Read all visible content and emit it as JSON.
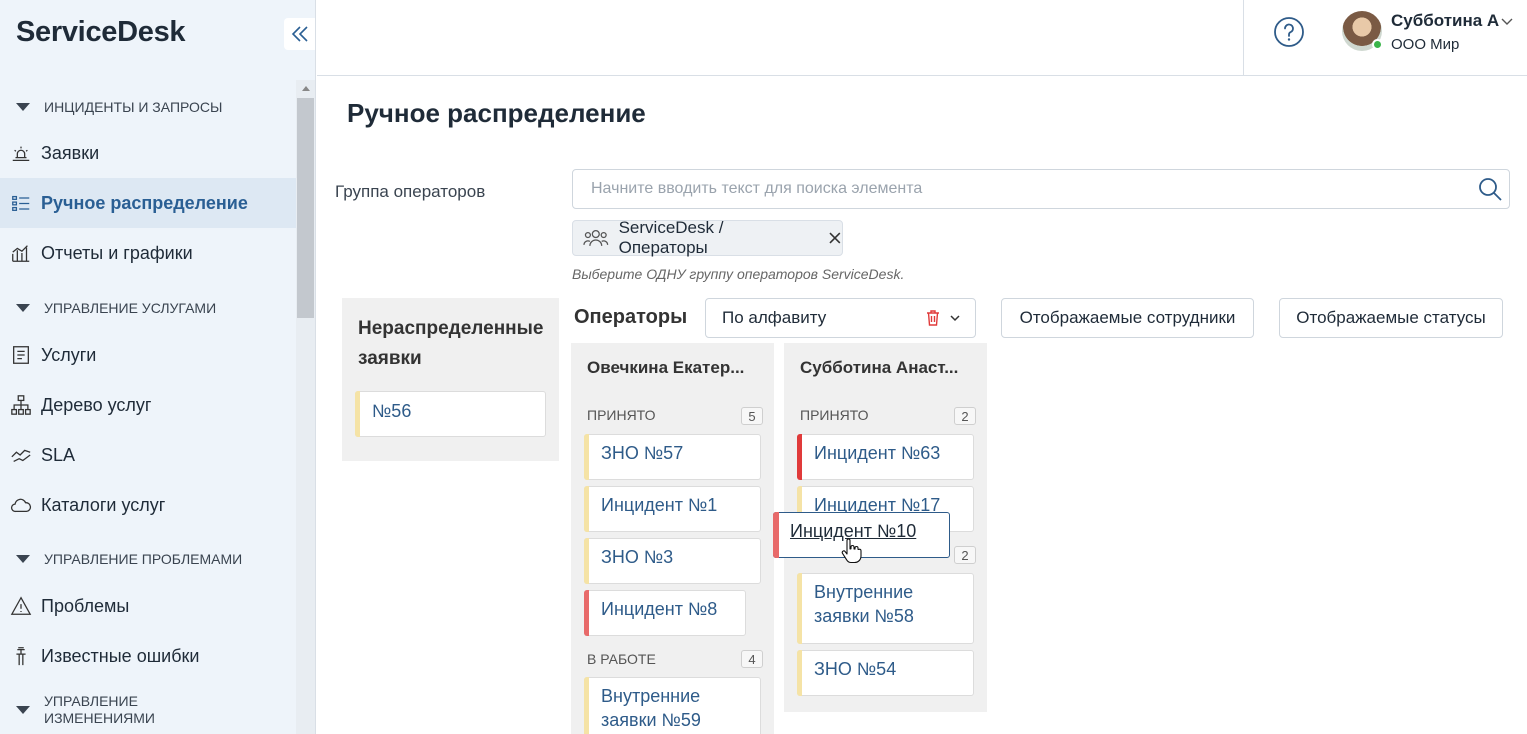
{
  "app": {
    "logo": "ServiceDesk"
  },
  "sidebar": {
    "sections": [
      {
        "label": "ИНЦИДЕНТЫ И ЗАПРОСЫ"
      },
      {
        "label": "УПРАВЛЕНИЕ УСЛУГАМИ"
      },
      {
        "label": "УПРАВЛЕНИЕ ПРОБЛЕМАМИ"
      },
      {
        "label": "УПРАВЛЕНИЕ ИЗМЕНЕНИЯМИ"
      }
    ],
    "items": [
      {
        "label": "Заявки",
        "icon": "requests-icon"
      },
      {
        "label": "Ручное распределение",
        "icon": "manual-distribution-icon",
        "active": true
      },
      {
        "label": "Отчеты и графики",
        "icon": "reports-icon"
      },
      {
        "label": "Услуги",
        "icon": "services-icon"
      },
      {
        "label": "Дерево услуг",
        "icon": "service-tree-icon"
      },
      {
        "label": "SLA",
        "icon": "sla-icon"
      },
      {
        "label": "Каталоги услуг",
        "icon": "catalog-cloud-icon"
      },
      {
        "label": "Проблемы",
        "icon": "warning-icon"
      },
      {
        "label": "Известные ошибки",
        "icon": "known-errors-icon"
      }
    ]
  },
  "header": {
    "user_name": "Субботина А",
    "user_org": "ООО Мир"
  },
  "page": {
    "title": "Ручное распределение",
    "group_label": "Группа операторов",
    "search_placeholder": "Начните вводить текст для поиска элемента",
    "selected_group": "ServiceDesk / Операторы",
    "hint": "Выберите ОДНУ группу операторов ServiceDesk.",
    "unassigned_title": "Нераспределенные заявки",
    "unassigned_cards": [
      "№56"
    ],
    "operators_label": "Операторы",
    "sort_value": "По алфавиту",
    "shown_employees_button": "Отображаемые сотрудники",
    "shown_statuses_button": "Отображаемые статусы"
  },
  "operators": [
    {
      "name": "Овечкина Екатер...",
      "statuses": [
        {
          "label": "ПРИНЯТО",
          "count": "5",
          "cards": [
            "ЗНО №57",
            "Инцидент №1",
            "ЗНО №3",
            "Инцидент №8"
          ]
        },
        {
          "label": "В РАБОТЕ",
          "count": "4",
          "cards": [
            "Внутренние заявки №59"
          ]
        }
      ]
    },
    {
      "name": "Субботина Анаст...",
      "statuses": [
        {
          "label": "ПРИНЯТО",
          "count": "2",
          "cards": [
            "Инцидент №63",
            "Инцидент №17"
          ]
        },
        {
          "label": "",
          "count": "2",
          "cards": [
            "Внутренние заявки №58",
            "ЗНО №54"
          ]
        }
      ]
    }
  ],
  "dragging_card": "Инцидент №10",
  "colors": {
    "accent": "#2e5b89",
    "priority_low": "#f5e3a6",
    "priority_high": "#e03a3a",
    "priority_medium": "#e86a6a"
  }
}
